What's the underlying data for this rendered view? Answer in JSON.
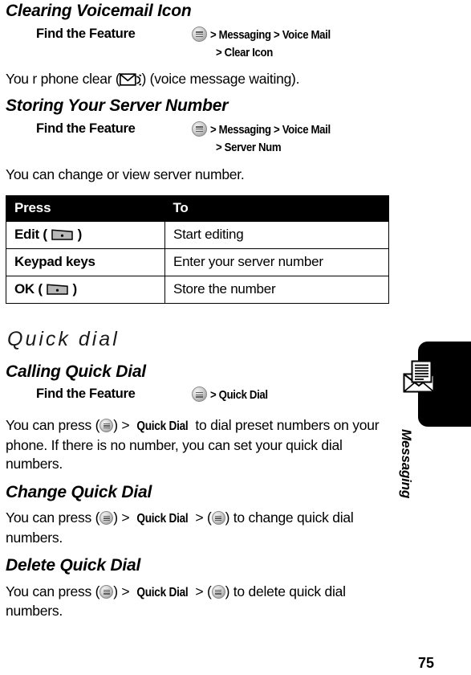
{
  "page": {
    "number": "75",
    "side_tab_label": "Messaging",
    "side_tab_icon": "envelope-message-icon"
  },
  "sections": [
    {
      "id": "clearing-voicemail-icon",
      "heading": "Clearing Voicemail Icon",
      "find_feature": {
        "label": "Find the Feature",
        "key_icon": "menu-key-icon",
        "line1": "> Messaging > Voice Mail",
        "line2": "> Clear Icon"
      },
      "body_before": "You r phone clear (",
      "body_icon": "voicemail-waiting-icon",
      "body_after": ") (voice message waiting)."
    },
    {
      "id": "storing-your-server-number",
      "heading": "Storing Your Server Number",
      "find_feature": {
        "label": "Find the Feature",
        "key_icon": "menu-key-icon",
        "line1": "> Messaging > Voice Mail",
        "line2": "> Server Num"
      },
      "body": "You can change or view server number."
    }
  ],
  "table": {
    "headers": [
      "Press",
      "To"
    ],
    "rows": [
      {
        "press_text": "Edit",
        "press_icon": "soft-key-icon",
        "has_icon": true,
        "to": "Start editing"
      },
      {
        "press_text": "Keypad keys",
        "press_icon": "",
        "has_icon": false,
        "to": "Enter your server number"
      },
      {
        "press_text": "OK",
        "press_icon": "soft-key-icon",
        "has_icon": true,
        "to": "Store the number"
      }
    ]
  },
  "quick_dial": {
    "section_heading": "Quick dial",
    "calling": {
      "heading": "Calling Quick Dial",
      "find_feature": {
        "label": "Find the Feature",
        "key_icon": "menu-key-icon",
        "line1": "> Quick Dial"
      },
      "body_p1": "You can press (",
      "body_p2": ") > ",
      "body_bold": "Quick Dial",
      "body_p3": " to dial preset numbers on your phone. If there is no number, you can set your quick dial numbers."
    },
    "change": {
      "heading": "Change Quick Dial",
      "body_p1": "You can press (",
      "body_p2": ") > ",
      "body_bold": "Quick Dial",
      "body_p3": " > (",
      "body_p4": ") to change quick dial numbers."
    },
    "delete": {
      "heading": "Delete Quick Dial",
      "body_p1": "You can press (",
      "body_p2": ") > ",
      "body_bold": "Quick Dial",
      "body_p3": " > (",
      "body_p4": ") to delete quick dial numbers."
    }
  },
  "colors": {
    "table_header_bg": "#000000",
    "table_header_fg": "#ffffff",
    "side_tab_bg": "#000000",
    "text": "#000000"
  }
}
